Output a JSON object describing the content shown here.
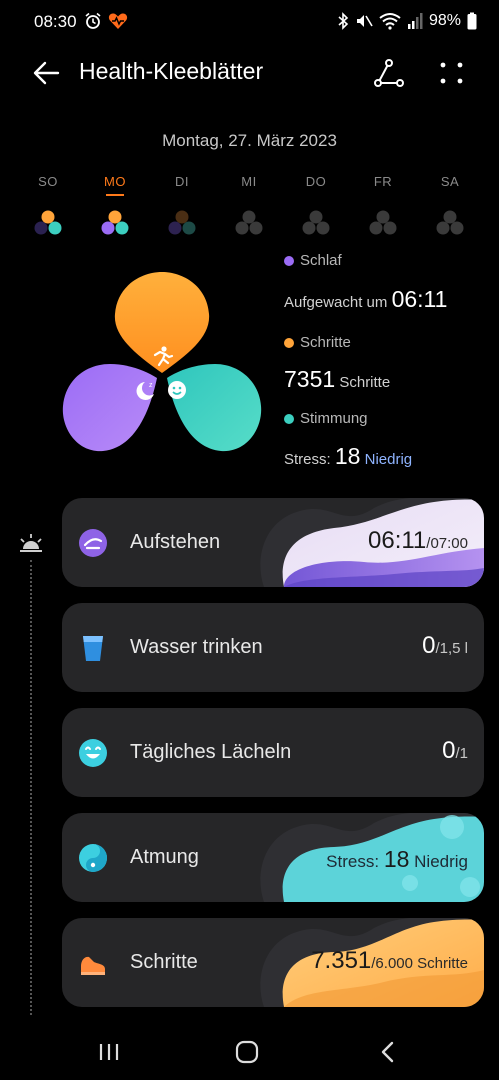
{
  "status_bar": {
    "time": "08:30",
    "battery": "98%",
    "icons": [
      "alarm-icon",
      "health-app-icon",
      "bluetooth-icon",
      "mute-icon",
      "wifi-icon",
      "signal-icon",
      "battery-icon"
    ]
  },
  "header": {
    "title": "Health-Kleeblätter",
    "icons": [
      "back-arrow-icon",
      "share-icon",
      "more-icon"
    ]
  },
  "date": "Montag, 27. März 2023",
  "week": [
    {
      "label": "SO",
      "active": false
    },
    {
      "label": "MO",
      "active": true
    },
    {
      "label": "DI",
      "active": false
    },
    {
      "label": "MI",
      "active": false
    },
    {
      "label": "DO",
      "active": false
    },
    {
      "label": "FR",
      "active": false
    },
    {
      "label": "SA",
      "active": false
    }
  ],
  "legend": {
    "sleep_label": "Schlaf",
    "sleep_prefix": "Aufgewacht um",
    "sleep_value": "06:11",
    "steps_label": "Schritte",
    "steps_value": "7351",
    "steps_unit": "Schritte",
    "mood_label": "Stimmung",
    "stress_prefix": "Stress:",
    "stress_value": "18",
    "stress_level": "Niedrig"
  },
  "cards": [
    {
      "name": "Aufstehen",
      "value": "06:11",
      "unit": "/07:00"
    },
    {
      "name": "Wasser trinken",
      "value": "0",
      "unit": "/1,5 l"
    },
    {
      "name": "Tägliches Lächeln",
      "value": "0",
      "unit": "/1"
    },
    {
      "name": "Atmung",
      "prefix": "Stress:",
      "value": "18",
      "unit": "Niedrig"
    },
    {
      "name": "Schritte",
      "value": "7.351",
      "unit": "/6.000 Schritte"
    }
  ],
  "colors": {
    "sleep": "#9b6cf5",
    "steps": "#ffa43a",
    "mood": "#3ccfc0",
    "accent": "#ff7a1a",
    "card_bg": "#262628"
  },
  "nav": [
    "recent-apps-icon",
    "home-icon",
    "back-icon"
  ]
}
